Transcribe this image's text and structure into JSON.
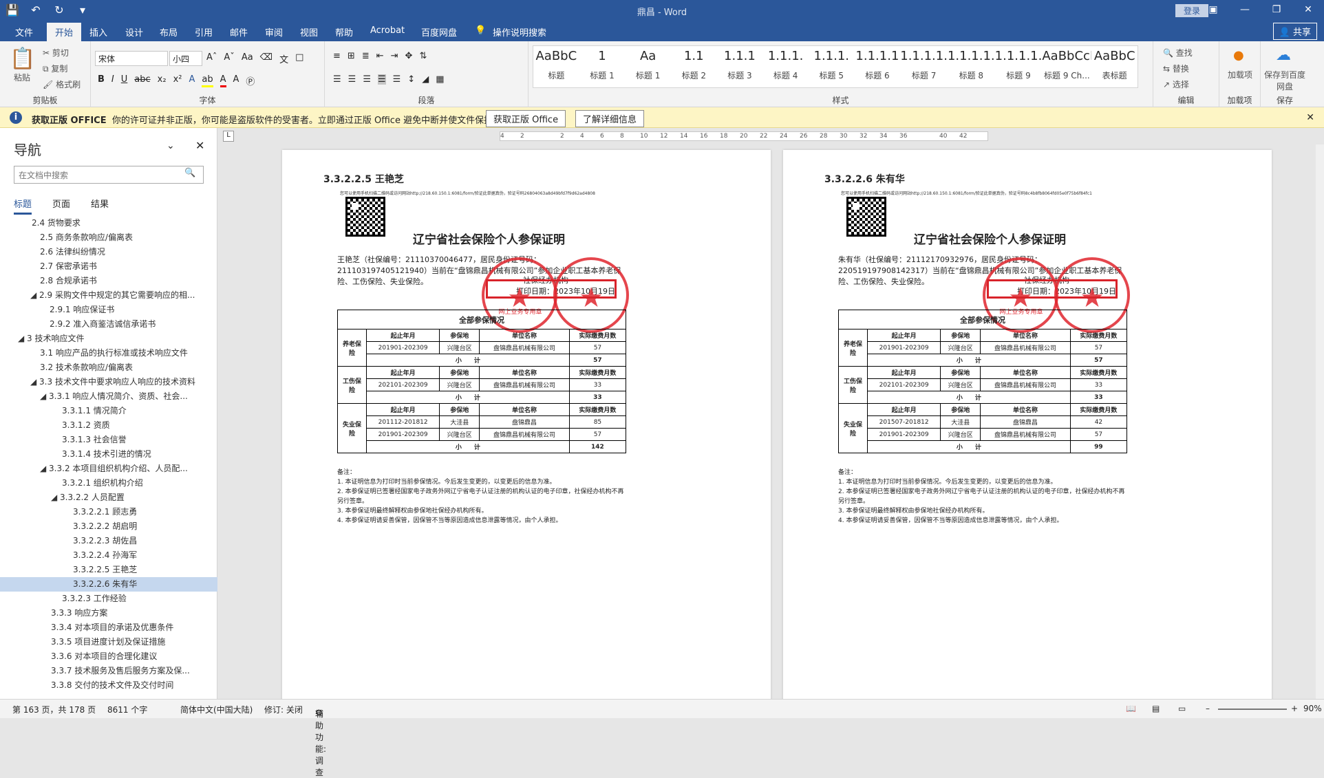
{
  "window": {
    "title": "鼎昌 - Word",
    "login_label": "登录",
    "share_label": "共享"
  },
  "tabs": [
    "文件",
    "开始",
    "插入",
    "设计",
    "布局",
    "引用",
    "邮件",
    "审阅",
    "视图",
    "帮助",
    "Acrobat",
    "百度网盘"
  ],
  "tell_me": "操作说明搜索",
  "ribbon": {
    "clipboard": {
      "paste": "粘贴",
      "cut": "剪切",
      "copy": "复制",
      "format_painter": "格式刷",
      "label": "剪贴板"
    },
    "font": {
      "name": "宋体",
      "size": "小四",
      "label": "字体"
    },
    "paragraph_label": "段落",
    "styles_label": "样式",
    "styles": [
      {
        "preview": "AaBbC",
        "name": "标题"
      },
      {
        "preview": "1",
        "name": "标题 1"
      },
      {
        "preview": "Aa",
        "name": "标题 1"
      },
      {
        "preview": "1.1",
        "name": "标题 2"
      },
      {
        "preview": "1.1.1",
        "name": "标题 3"
      },
      {
        "preview": "1.1.1.",
        "name": "标题 4"
      },
      {
        "preview": "1.1.1.",
        "name": "标题 5"
      },
      {
        "preview": "1.1.1.1",
        "name": "标题 6"
      },
      {
        "preview": "1.1.1.1.",
        "name": "标题 7"
      },
      {
        "preview": "1.1.1.1.",
        "name": "标题 8"
      },
      {
        "preview": "1.1.1.1.",
        "name": "标题 9"
      },
      {
        "preview": "AaBbCcDd",
        "name": "标题 9 Ch..."
      },
      {
        "preview": "AaBbC",
        "name": "表标题"
      }
    ],
    "editing": {
      "find": "查找",
      "replace": "替换",
      "select": "选择",
      "label": "编辑"
    },
    "addins": {
      "btn": "加载项",
      "label": "加载项"
    },
    "save": {
      "btn": "保存到百度网盘",
      "label": "保存"
    }
  },
  "infobar": {
    "title": "获取正版 OFFICE",
    "message": "你的许可证并非正版，你可能是盗版软件的受害者。立即通过正版 Office 避免中断并使文件保持安全。",
    "btn1": "获取正版 Office",
    "btn2": "了解详细信息"
  },
  "nav": {
    "title": "导航",
    "search_placeholder": "在文档中搜索",
    "tabs": [
      "标题",
      "页面",
      "结果"
    ],
    "items": [
      {
        "text": "2.4 货物要求",
        "indent": 46
      },
      {
        "text": "2.5 商务条款响应/偏离表",
        "indent": 58
      },
      {
        "text": "2.6 法律纠纷情况",
        "indent": 58
      },
      {
        "text": "2.7 保密承诺书",
        "indent": 58
      },
      {
        "text": "2.8 合规承诺书",
        "indent": 58
      },
      {
        "text": "◢ 2.9 采购文件中规定的其它需要响应的相...",
        "indent": 44
      },
      {
        "text": "2.9.1 响应保证书",
        "indent": 72
      },
      {
        "text": "2.9.2 准入商鉴洁诚信承诺书",
        "indent": 72
      },
      {
        "text": "◢ 3 技术响应文件",
        "indent": 26
      },
      {
        "text": "3.1 响应产品的执行标准或技术响应文件",
        "indent": 58
      },
      {
        "text": "3.2 技术条款响应/偏离表",
        "indent": 58
      },
      {
        "text": "◢ 3.3 技术文件中要求响应人响应的技术资料",
        "indent": 44
      },
      {
        "text": "◢ 3.3.1 响应人情况简介、资质、社会...",
        "indent": 58
      },
      {
        "text": "3.3.1.1 情况简介",
        "indent": 90
      },
      {
        "text": "3.3.1.2 资质",
        "indent": 90
      },
      {
        "text": "3.3.1.3 社会信誉",
        "indent": 90
      },
      {
        "text": "3.3.1.4 技术引进的情况",
        "indent": 90
      },
      {
        "text": "◢ 3.3.2 本项目组织机构介绍、人员配...",
        "indent": 58
      },
      {
        "text": "3.3.2.1 组织机构介绍",
        "indent": 90
      },
      {
        "text": "◢ 3.3.2.2 人员配置",
        "indent": 74
      },
      {
        "text": "3.3.2.2.1 顾志勇",
        "indent": 106
      },
      {
        "text": "3.3.2.2.2 胡启明",
        "indent": 106
      },
      {
        "text": "3.3.2.2.3 胡佐昌",
        "indent": 106
      },
      {
        "text": "3.3.2.2.4 孙海军",
        "indent": 106
      },
      {
        "text": "3.3.2.2.5 王艳芝",
        "indent": 106
      },
      {
        "text": "3.3.2.2.6 朱有华",
        "indent": 106,
        "selected": true
      },
      {
        "text": "3.3.2.3 工作经验",
        "indent": 90
      },
      {
        "text": "3.3.3 响应方案",
        "indent": 74
      },
      {
        "text": "3.3.4 对本项目的承诺及优惠条件",
        "indent": 74
      },
      {
        "text": "3.3.5 项目进度计划及保证措施",
        "indent": 74
      },
      {
        "text": "3.3.6 对本项目的合理化建议",
        "indent": 74
      },
      {
        "text": "3.3.7 技术服务及售后服务方案及保...",
        "indent": 74
      },
      {
        "text": "3.3.8 交付的技术文件及交付时间",
        "indent": 74
      }
    ]
  },
  "ruler_ticks": [
    "4",
    "2",
    "",
    "2",
    "4",
    "6",
    "8",
    "10",
    "12",
    "14",
    "16",
    "18",
    "20",
    "22",
    "24",
    "26",
    "28",
    "30",
    "32",
    "34",
    "36",
    "",
    "40",
    "42"
  ],
  "pages": [
    {
      "heading": "3.3.2.2.5  王艳芝",
      "smallprint": "您可以使用手机扫描二维码或访问网站http://218.60.150.1:6081/form/验证此单据真伪，验证号码26804063a8d49bfd7f9d62ad4808",
      "cert_title": "辽宁省社会保险个人参保证明",
      "body": "王艳芝（社保编号：21110370046477，居民身份证号码：211103197405121940）当前在“盘锦鼎昌机械有限公司”参加企业职工基本养老保险、工伤保险、失业保险。",
      "org": "社保经办机构",
      "print_date": "打印日期：2023年10月19日",
      "table_header": "全部参保情况",
      "sections": [
        {
          "type": "养老保险",
          "rows": [
            [
              "201901-202309",
              "兴隆台区",
              "盘锦鼎昌机械有限公司",
              "57"
            ]
          ],
          "subtotal": "57"
        },
        {
          "type": "工伤保险",
          "rows": [
            [
              "202101-202309",
              "兴隆台区",
              "盘锦鼎昌机械有限公司",
              "33"
            ]
          ],
          "subtotal": "33"
        },
        {
          "type": "失业保险",
          "rows": [
            [
              "201112-201812",
              "大洼县",
              "盘锦鼎昌",
              "85"
            ],
            [
              "201901-202309",
              "兴隆台区",
              "盘锦鼎昌机械有限公司",
              "57"
            ]
          ],
          "subtotal": "142"
        }
      ],
      "notes": [
        "备注：",
        "1. 本证明信息为打印时当前参保情况。今后发生变更的，以变更后的信息为准。",
        "2. 本参保证明已签署经国家电子政务外网辽宁省电子认证注册的机构认证的电子印章，社保经办机构不再另行签章。",
        "3. 本参保证明最终解释权由参保地社保经办机构所有。",
        "4. 本参保证明请妥善保管，因保管不当等原因造成信息泄露等情况，由个人承担。"
      ]
    },
    {
      "heading": "3.3.2.2.6  朱有华",
      "smallprint": "您可以使用手机扫描二维码或访问网站http://218.60.150.1:6081/form/验证此单据真伪，验证号码8c4b8fb8064fd05e0f75b6f84fc1",
      "cert_title": "辽宁省社会保险个人参保证明",
      "body": "朱有华（社保编号：21112170932976，居民身份证号码：220519197908142317）当前在“盘锦鼎昌机械有限公司”参加企业职工基本养老保险、工伤保险、失业保险。",
      "org": "社保经办机构",
      "print_date": "打印日期：2023年10月19日",
      "table_header": "全部参保情况",
      "sections": [
        {
          "type": "养老保险",
          "rows": [
            [
              "201901-202309",
              "兴隆台区",
              "盘锦鼎昌机械有限公司",
              "57"
            ]
          ],
          "subtotal": "57"
        },
        {
          "type": "工伤保险",
          "rows": [
            [
              "202101-202309",
              "兴隆台区",
              "盘锦鼎昌机械有限公司",
              "33"
            ]
          ],
          "subtotal": "33"
        },
        {
          "type": "失业保险",
          "rows": [
            [
              "201507-201812",
              "大洼县",
              "盘锦鼎昌",
              "42"
            ],
            [
              "201901-202309",
              "兴隆台区",
              "盘锦鼎昌机械有限公司",
              "57"
            ]
          ],
          "subtotal": "99"
        }
      ],
      "notes": [
        "备注：",
        "1. 本证明信息为打印时当前参保情况。今后发生变更的，以变更后的信息为准。",
        "2. 本参保证明已签署经国家电子政务外网辽宁省电子认证注册的机构认证的电子印章，社保经办机构不再另行签章。",
        "3. 本参保证明最终解释权由参保地社保经办机构所有。",
        "4. 本参保证明请妥善保管，因保管不当等原因造成信息泄露等情况，由个人承担。"
      ]
    }
  ],
  "table_cols": {
    "period": "起止年月",
    "place": "参保地",
    "unit": "单位名称",
    "months": "实际缴费月数",
    "subtotal": "小　　计"
  },
  "stamp": {
    "text": "网上业务专用章"
  },
  "status": {
    "page": "第 163 页，共 178 页",
    "words": "8611 个字",
    "lang": "简体中文(中国大陆)",
    "track": "修订: 关闭",
    "access": "辅助功能: 调查",
    "zoom": "90%"
  },
  "colors": {
    "brand": "#2b579a",
    "stamp": "#e0262e"
  }
}
